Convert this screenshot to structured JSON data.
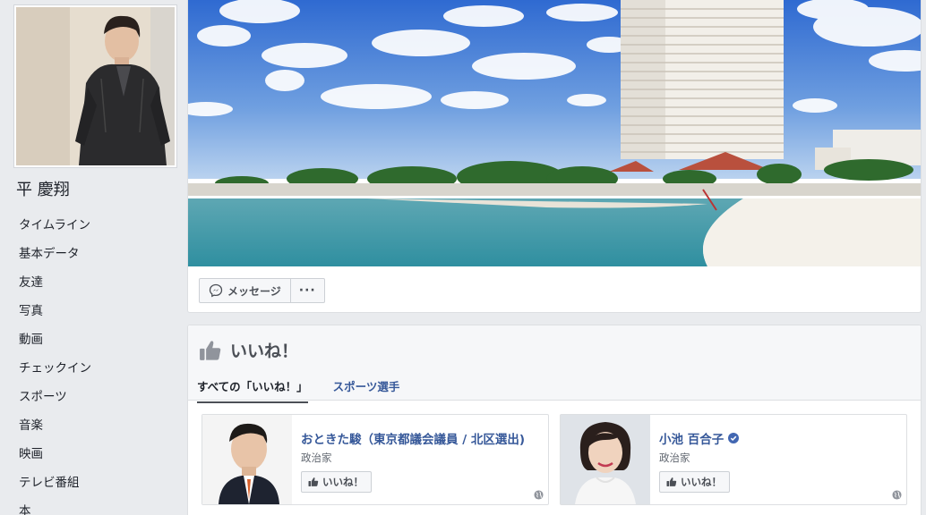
{
  "profile": {
    "name": "平 慶翔"
  },
  "nav": {
    "items": [
      "タイムライン",
      "基本データ",
      "友達",
      "写真",
      "動画",
      "チェックイン",
      "スポーツ",
      "音楽",
      "映画",
      "テレビ番組",
      "本"
    ]
  },
  "actions": {
    "message_label": "メッセージ",
    "more_label": "···"
  },
  "likes": {
    "title": "いいね！",
    "tabs": [
      "すべての「いいね！」",
      "スポーツ選手"
    ],
    "items": [
      {
        "name": "おときた駿（東京都議会議員 / 北区選出)",
        "category": "政治家",
        "button": "いいね！",
        "verified": false
      },
      {
        "name": "小池 百合子",
        "category": "政治家",
        "button": "いいね！",
        "verified": true
      }
    ]
  },
  "colors": {
    "link": "#365899",
    "page_bg": "#e9ebee",
    "verified_badge": "#4267b2"
  }
}
